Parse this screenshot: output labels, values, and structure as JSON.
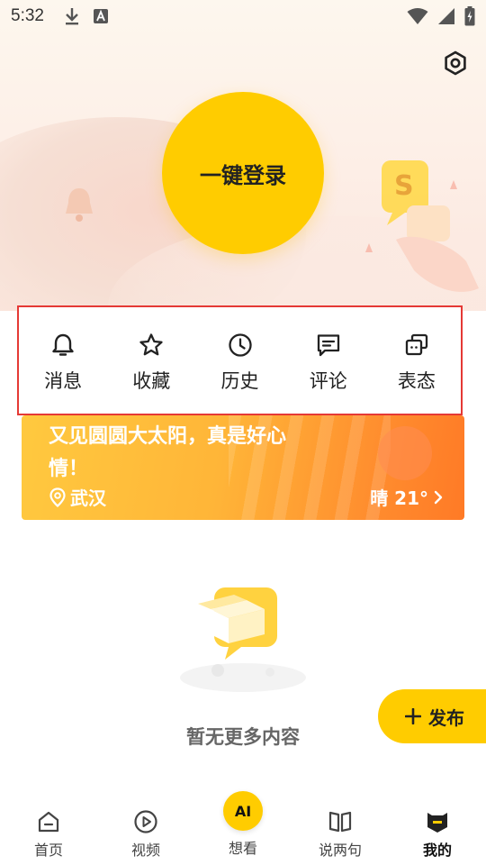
{
  "status_bar": {
    "time": "5:32"
  },
  "login": {
    "label": "一键登录"
  },
  "quick_menu": [
    {
      "id": "messages",
      "label": "消息",
      "icon": "bell-icon"
    },
    {
      "id": "favorites",
      "label": "收藏",
      "icon": "star-icon"
    },
    {
      "id": "history",
      "label": "历史",
      "icon": "clock-icon"
    },
    {
      "id": "comments",
      "label": "评论",
      "icon": "comment-icon"
    },
    {
      "id": "attitudes",
      "label": "表态",
      "icon": "cards-icon"
    }
  ],
  "weather": {
    "headline": "又见圆圆大太阳，真是好心情！",
    "location": "武汉",
    "condition": "晴 21°"
  },
  "empty_state": {
    "text": "暂无更多内容"
  },
  "publish": {
    "label": "发布"
  },
  "bottom_nav": [
    {
      "id": "home",
      "label": "首页",
      "icon": "home-icon"
    },
    {
      "id": "video",
      "label": "视频",
      "icon": "play-icon"
    },
    {
      "id": "ai",
      "label": "想看",
      "icon": "ai-icon",
      "badge": "AI"
    },
    {
      "id": "quotes",
      "label": "说两句",
      "icon": "book-icon"
    },
    {
      "id": "mine",
      "label": "我的",
      "icon": "profile-icon",
      "active": true
    }
  ],
  "colors": {
    "brand": "#ffcc00",
    "highlight_border": "#e53935",
    "weather_start": "#ffc93f",
    "weather_end": "#ff7a26"
  }
}
